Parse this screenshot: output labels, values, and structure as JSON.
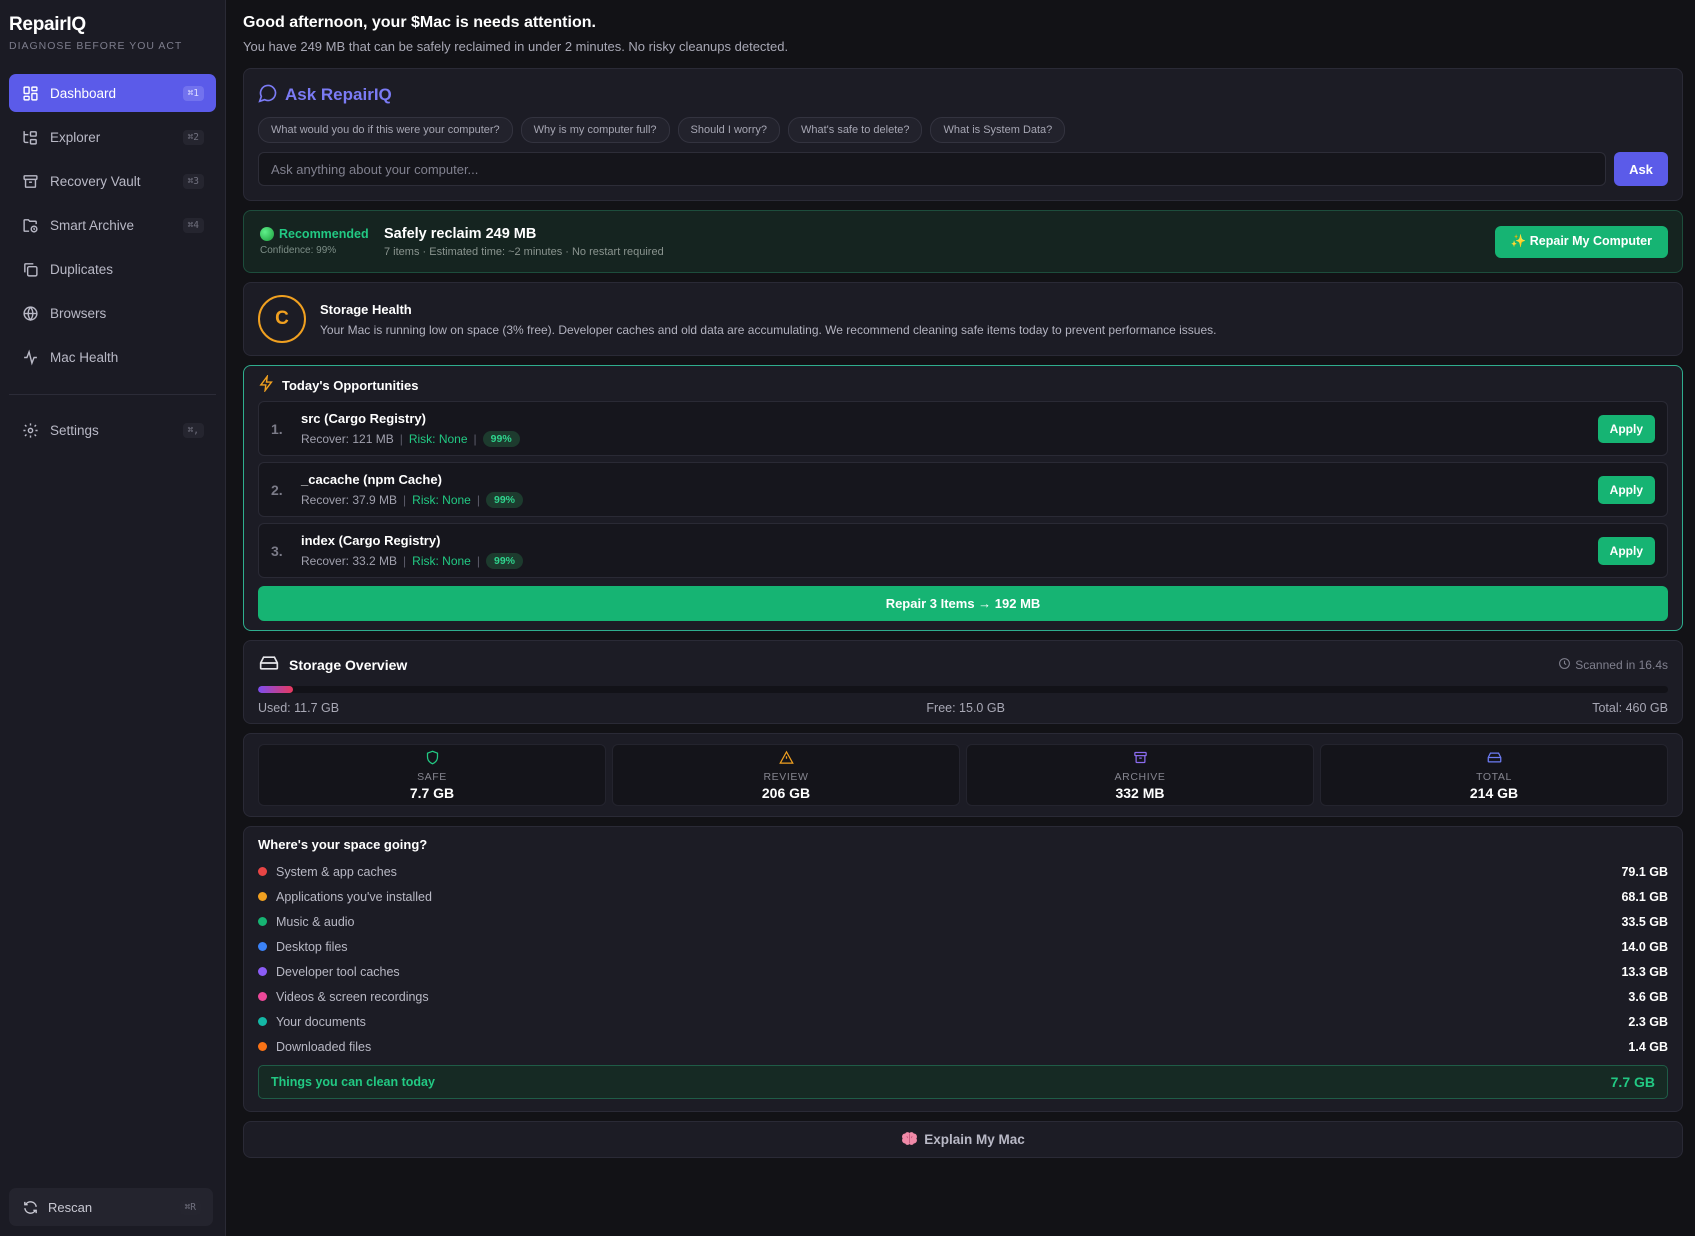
{
  "app": {
    "name": "RepairIQ",
    "tagline": "DIAGNOSE BEFORE YOU ACT"
  },
  "sidebar": {
    "items": [
      {
        "label": "Dashboard",
        "shortcut": "⌘1",
        "icon": "grid-icon"
      },
      {
        "label": "Explorer",
        "shortcut": "⌘2",
        "icon": "tree-icon"
      },
      {
        "label": "Recovery Vault",
        "shortcut": "⌘3",
        "icon": "archive-icon"
      },
      {
        "label": "Smart Archive",
        "shortcut": "⌘4",
        "icon": "folder-clock-icon"
      },
      {
        "label": "Duplicates",
        "shortcut": "",
        "icon": "copy-icon"
      },
      {
        "label": "Browsers",
        "shortcut": "",
        "icon": "globe-icon"
      },
      {
        "label": "Mac Health",
        "shortcut": "",
        "icon": "pulse-icon"
      }
    ],
    "settings": {
      "label": "Settings",
      "shortcut": "⌘,"
    },
    "rescan": {
      "label": "Rescan",
      "shortcut": "⌘R"
    }
  },
  "greeting": {
    "title": "Good afternoon, your $Mac is needs attention.",
    "subtitle": "You have 249 MB that can be safely reclaimed in under 2 minutes. No risky cleanups detected."
  },
  "ask": {
    "title": "Ask RepairIQ",
    "chips": [
      "What would you do if this were your computer?",
      "Why is my computer full?",
      "Should I worry?",
      "What's safe to delete?",
      "What is System Data?"
    ],
    "placeholder": "Ask anything about your computer...",
    "button": "Ask"
  },
  "recommended": {
    "badge": "Recommended",
    "confidence": "Confidence: 99%",
    "title": "Safely reclaim 249 MB",
    "subtitle": "7 items · Estimated time: ~2 minutes · No restart required",
    "button": "✨ Repair My Computer"
  },
  "health": {
    "grade": "C",
    "title": "Storage Health",
    "description": "Your Mac is running low on space (3% free). Developer caches and old data are accumulating. We recommend cleaning safe items today to prevent performance issues."
  },
  "opportunities": {
    "title": "Today's Opportunities",
    "items": [
      {
        "num": "1.",
        "name": "src (Cargo Registry)",
        "recover": "Recover: 121 MB",
        "risk": "Risk: None",
        "confidence": "99%",
        "action": "Apply"
      },
      {
        "num": "2.",
        "name": "_cacache (npm Cache)",
        "recover": "Recover: 37.9 MB",
        "risk": "Risk: None",
        "confidence": "99%",
        "action": "Apply"
      },
      {
        "num": "3.",
        "name": "index (Cargo Registry)",
        "recover": "Recover: 33.2 MB",
        "risk": "Risk: None",
        "confidence": "99%",
        "action": "Apply"
      }
    ],
    "repair_all": "Repair 3 Items → 192 MB"
  },
  "overview": {
    "title": "Storage Overview",
    "scanned": "Scanned in 16.4s",
    "used_fraction": 0.025,
    "used": "Used: 11.7 GB",
    "free": "Free: 15.0 GB",
    "total": "Total: 460 GB"
  },
  "tiles": [
    {
      "label": "SAFE",
      "value": "7.7 GB",
      "icon": "shield-icon",
      "color": "#22c983"
    },
    {
      "label": "REVIEW",
      "value": "206 GB",
      "icon": "warning-icon",
      "color": "#f0a020"
    },
    {
      "label": "ARCHIVE",
      "value": "332 MB",
      "icon": "archive-icon",
      "color": "#8b6cf0"
    },
    {
      "label": "TOTAL",
      "value": "214 GB",
      "icon": "drive-icon",
      "color": "#6d7cf5"
    }
  ],
  "breakdown": {
    "title": "Where's your space going?",
    "items": [
      {
        "name": "System & app caches",
        "size": "79.1 GB",
        "color": "#e84545"
      },
      {
        "name": "Applications you've installed",
        "size": "68.1 GB",
        "color": "#f0a020"
      },
      {
        "name": "Music & audio",
        "size": "33.5 GB",
        "color": "#16b473"
      },
      {
        "name": "Desktop files",
        "size": "14.0 GB",
        "color": "#3b82f6"
      },
      {
        "name": "Developer tool caches",
        "size": "13.3 GB",
        "color": "#8b5cf6"
      },
      {
        "name": "Videos & screen recordings",
        "size": "3.6 GB",
        "color": "#ec4899"
      },
      {
        "name": "Your documents",
        "size": "2.3 GB",
        "color": "#14b8a6"
      },
      {
        "name": "Downloaded files",
        "size": "1.4 GB",
        "color": "#f97316"
      }
    ],
    "clean_label": "Things you can clean today",
    "clean_value": "7.7 GB"
  },
  "explain": {
    "label": "Explain My Mac",
    "icon": "brain-icon"
  }
}
